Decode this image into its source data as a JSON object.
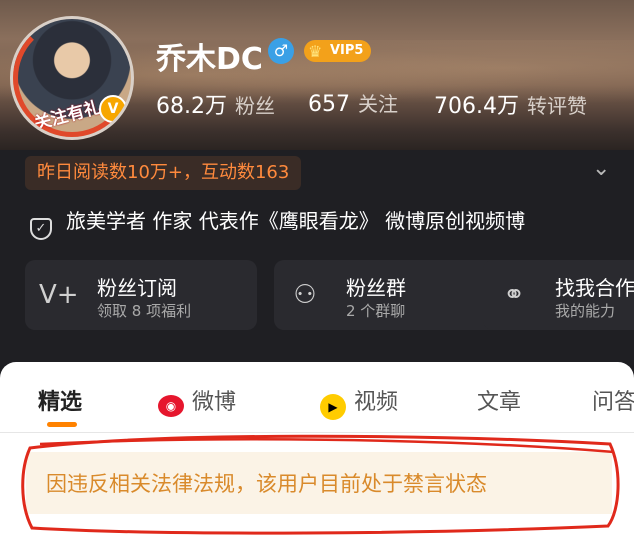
{
  "profile": {
    "avatar_badge": "关注有礼",
    "name": "乔木DC",
    "gender_icon": "male-icon",
    "vip_label": "VIP5",
    "stats": [
      {
        "value": "68.2万",
        "label": "粉丝"
      },
      {
        "value": "657",
        "label": "关注"
      },
      {
        "value": "706.4万",
        "label": "转评赞"
      }
    ],
    "read_stats": "昨日阅读数10万+，互动数163",
    "verification": "旅美学者 作家 代表作《鹰眼看龙》 微博原创视频博"
  },
  "cards": [
    {
      "title": "粉丝订阅",
      "subtitle": "领取 8 项福利",
      "icon": "v-plus-icon"
    },
    {
      "title": "粉丝群",
      "subtitle": "2 个群聊",
      "icon": "group-icon"
    },
    {
      "title": "找我合作",
      "subtitle": "我的能力",
      "icon": "handshake-icon"
    }
  ],
  "tabs": [
    {
      "label": "精选",
      "active": true
    },
    {
      "label": "微博",
      "icon": "weibo-icon"
    },
    {
      "label": "视频",
      "icon": "video-icon"
    },
    {
      "label": "文章"
    },
    {
      "label": "问答"
    }
  ],
  "notice": "因违反相关法律法规，该用户目前处于禁言状态",
  "colors": {
    "accent": "#ff8200",
    "notice_text": "#d98a2b",
    "notice_bg": "#fbf3e6",
    "annotation_red": "#e0291b",
    "vip": "#f3a11a",
    "gender": "#3aa0e6"
  }
}
